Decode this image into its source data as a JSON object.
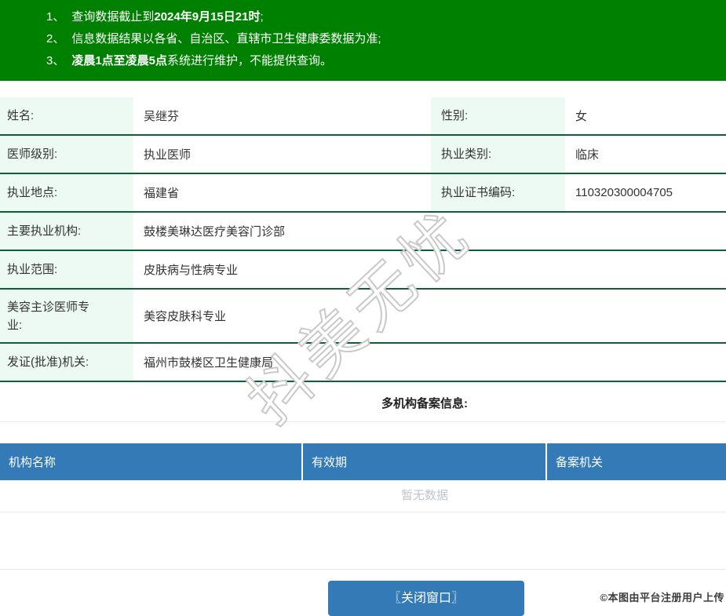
{
  "banner": {
    "notices": [
      {
        "num": "1、",
        "segments": [
          {
            "t": "查询数据截止到",
            "b": false
          },
          {
            "t": "2024年9月15日21时",
            "b": true
          },
          {
            "t": ";",
            "b": false
          }
        ]
      },
      {
        "num": "2、",
        "segments": [
          {
            "t": "信息数据结果以各省、自治区、直辖市卫生健康委数据为准;",
            "b": false
          }
        ]
      },
      {
        "num": "3、",
        "segments": [
          {
            "t": "凌晨1点至凌晨5点",
            "b": true
          },
          {
            "t": "系统进行维护，不能提供查询。",
            "b": false
          }
        ]
      }
    ]
  },
  "info_table": {
    "rows": [
      {
        "cells": [
          {
            "label": "姓名:",
            "value": "吴继芬"
          },
          {
            "label": "性别:",
            "value": "女"
          }
        ]
      },
      {
        "cells": [
          {
            "label": "医师级别:",
            "value": "执业医师"
          },
          {
            "label": "执业类别:",
            "value": "临床"
          }
        ]
      },
      {
        "cells": [
          {
            "label": "执业地点:",
            "value": "福建省"
          },
          {
            "label": "执业证书编码:",
            "value": "110320300004705"
          }
        ]
      },
      {
        "cells": [
          {
            "label": "主要执业机构:",
            "value": "鼓楼美琳达医疗美容门诊部"
          }
        ]
      },
      {
        "cells": [
          {
            "label": "执业范围:",
            "value": "皮肤病与性病专业"
          }
        ]
      },
      {
        "tall": true,
        "cells": [
          {
            "label": "美容主诊医师专业:",
            "value": "美容皮肤科专业"
          }
        ]
      },
      {
        "cells": [
          {
            "label": "发证(批准)机关:",
            "value": "福州市鼓楼区卫生健康局"
          }
        ]
      }
    ]
  },
  "multi_org": {
    "title": "多机构备案信息:",
    "columns": [
      "机构名称",
      "有效期",
      "备案机关"
    ],
    "empty_text": "暂无数据"
  },
  "footer": {
    "close_button": "〖关闭窗口〗",
    "upload_note": "©本图由平台注册用户上传"
  },
  "watermark": {
    "text": "抖美无忧"
  },
  "colors": {
    "banner_bg": "#008000",
    "divider": "#0e5f38",
    "label_bg": "#edfaf3",
    "table_head_bg": "#337ab7",
    "button_bg": "#337ab7",
    "empty_text": "#c0c4cc"
  }
}
